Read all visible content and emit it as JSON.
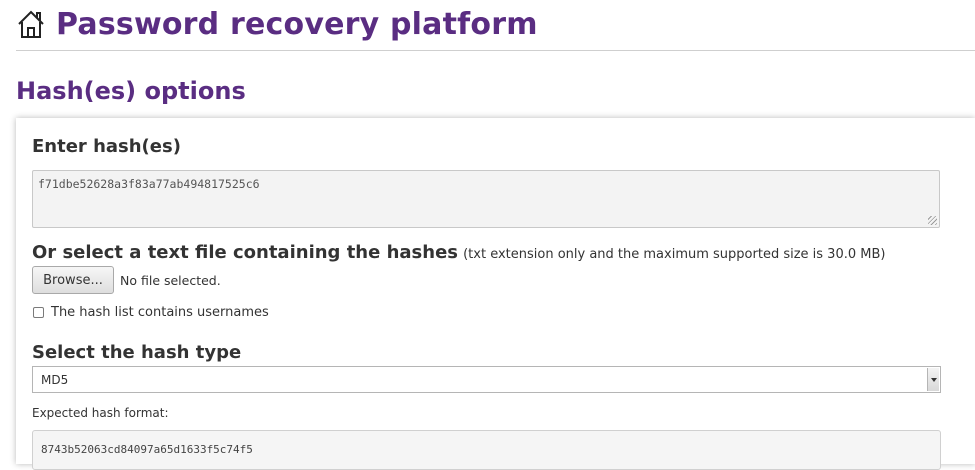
{
  "header": {
    "home_icon": "home-icon",
    "title": "Password recovery platform"
  },
  "section": {
    "title": "Hash(es) options"
  },
  "hash_input": {
    "label": "Enter hash(es)",
    "value": "f71dbe52628a3f83a77ab494817525c6"
  },
  "file_upload": {
    "label": "Or select a text file containing the hashes",
    "note": "(txt extension only and the maximum supported size is 30.0 MB)",
    "button_label": "Browse...",
    "status": "No file selected."
  },
  "usernames_option": {
    "label": "The hash list contains usernames",
    "checked": false
  },
  "hash_type": {
    "label": "Select the hash type",
    "selected": "MD5"
  },
  "expected_format": {
    "label": "Expected hash format:",
    "value": "8743b52063cd84097a65d1633f5c74f5"
  },
  "colors": {
    "accent": "#5a2d82"
  }
}
